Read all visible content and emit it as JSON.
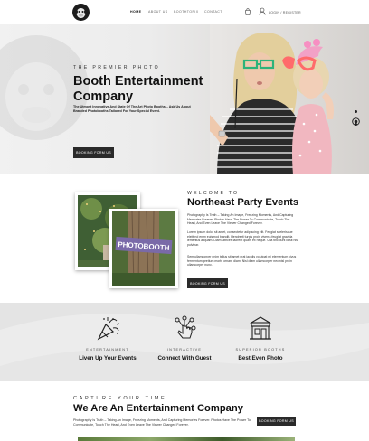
{
  "header": {
    "nav": [
      {
        "label": "HOME",
        "active": true
      },
      {
        "label": "ABOUT US",
        "active": false
      },
      {
        "label": "BOOTHTOPIX",
        "active": false
      },
      {
        "label": "CONTACT",
        "active": false
      }
    ],
    "login_label": "LOGIN / REGISTER",
    "icons": [
      "logo-monkey-icon",
      "cart-icon",
      "user-icon"
    ]
  },
  "hero": {
    "subtitle": "THE PREMIER PHOTO",
    "title": "Booth Entertainment Company",
    "text": "The Utmost Innovative And State Of The Art Photo Booths... Ask Us About Branded Photobooths Tailored For Your Special Event.",
    "button": "BOOKING FORM US"
  },
  "welcome": {
    "subtitle": "WELCOME TO",
    "title": "Northeast Party Events",
    "p1": "Photography Is Truth – Taking An Image, Freezing Moments, And Capturing Memories Forever. Photos Have The Power To Communicate, Touch The Heart, And Even Leave The Viewer Changed Forever.",
    "p2": "Lorem ipsum dolor sit amet, consectetur adipiscing elit. Feugiat scelerisque eleifend enim euismod blandit. Hendrerit turpis proin viverra feugiat gravida lementus aliquam. Diam ultrices laoreet quam ex neque. Ulla tincidunt id sit nisl pulvinar.",
    "p3": "Sem ullamcorper enim tellus sit amet erat iaculis volutpat mi elementum vivus fermentum pretium morbi ornare diam. Nisl diam ullamcorper nec nisl proin ullamcorper nunc.",
    "button": "BOOKING FORM US",
    "photo_caption": "PHOTOBOOTH"
  },
  "features": [
    {
      "icon": "party-popper-icon",
      "label": "ENTERTAINMENT",
      "title": "Liven Up Your Events"
    },
    {
      "icon": "hand-network-icon",
      "label": "INTERACTIVE",
      "title": "Connect With Guest"
    },
    {
      "icon": "booth-store-icon",
      "label": "SUPERIOR BOOTHS",
      "title": "Best Even Photo"
    }
  ],
  "capture": {
    "subtitle": "CAPTURE YOUR TIME",
    "title": "We Are An Entertainment Company",
    "text": "Photography Is Truth – Taking An Image, Freezing Moments, And Capturing Memories Forever. Photos Have The Power To Communicate, Touch The Heart, And Even Leave The Viewer Changed Forever.",
    "button": "BOOKING FORM US"
  },
  "colors": {
    "dark": "#2a2a2a",
    "hero_bg": "#ececec",
    "band_bg": "#ececec",
    "accent_green": "#2db37a",
    "accent_pink": "#ff6b6b"
  }
}
